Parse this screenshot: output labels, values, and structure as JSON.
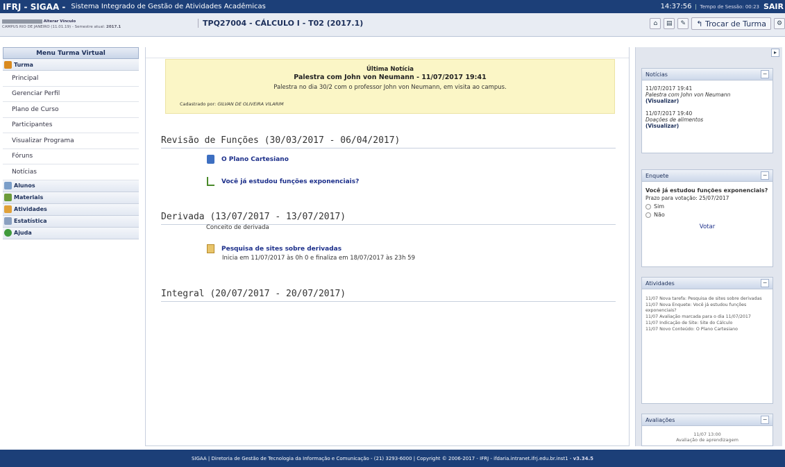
{
  "topbar": {
    "app_title": "IFRJ - SIGAA -",
    "system_name": "Sistema Integrado de Gestão de Atividades Acadêmicas",
    "time": "14:37:56",
    "session": "Tempo de Sessão: 00:23",
    "logout": "SAIR"
  },
  "header": {
    "change_link": "Alterar Vínculo",
    "campus": "CAMPUS RIO DE JANEIRO (11.01.19) - Semestre atual:",
    "semester": "2017.1",
    "course_title": "TPQ27004 - CÁLCULO I - T02 (2017.1)",
    "change_class": "Trocar de Turma"
  },
  "sidebar": {
    "title": "Menu Turma Virtual",
    "sections": [
      {
        "label": "Turma",
        "color": "#d98a1f"
      },
      {
        "label": "Alunos",
        "color": "#7a9ec9"
      },
      {
        "label": "Materiais",
        "color": "#6c9b3a"
      },
      {
        "label": "Atividades",
        "color": "#e0a13a"
      },
      {
        "label": "Estatística",
        "color": "#8aa0c0"
      },
      {
        "label": "Ajuda",
        "color": "#3f9a3c"
      }
    ],
    "turma_items": [
      "Principal",
      "Gerenciar Perfil",
      "Plano de Curso",
      "Participantes",
      "Visualizar Programa",
      "Fóruns",
      "Notícias"
    ]
  },
  "news": {
    "label": "Última Notícia",
    "headline": "Palestra com John von Neumann - 11/07/2017 19:41",
    "text": "Palestra no dia 30/2 com o professor John von Neumann, em visita ao campus.",
    "author_prefix": "Cadastrado por:",
    "author": "GILVAN DE OLIVEIRA VILARIM"
  },
  "topics": [
    {
      "title": "Revisão de Funções (30/03/2017 - 06/04/2017)"
    },
    {
      "title": "Derivada (13/07/2017 - 13/07/2017)",
      "subtitle": "Conceito de derivada"
    },
    {
      "title": "Integral (20/07/2017 - 20/07/2017)"
    }
  ],
  "resources": {
    "plano": "O Plano Cartesiano",
    "enquete": "Você já estudou funções exponenciais?",
    "pesquisa": "Pesquisa de sites sobre derivadas",
    "pesquisa_detail": "Inicia em 11/07/2017 às 0h 0 e finaliza em 18/07/2017 às 23h 59"
  },
  "right": {
    "noticias": {
      "title": "Notícias",
      "items": [
        {
          "date": "11/07/2017 19:41",
          "text": "Palestra com John von Neumann",
          "link": "(Visualizar)"
        },
        {
          "date": "11/07/2017 19:40",
          "text": "Doações de alimentos",
          "link": "(Visualizar)"
        }
      ]
    },
    "enquete": {
      "title": "Enquete",
      "question": "Você já estudou funções exponenciais?",
      "deadline": "Prazo para votação: 25/07/2017",
      "options": [
        "Sim",
        "Não"
      ],
      "vote": "Votar"
    },
    "atividades": {
      "title": "Atividades",
      "items": [
        "11/07 Nova tarefa: Pesquisa de sites sobre derivadas",
        "11/07 Nova Enquete: Você já estudou funções exponenciais?",
        "11/07 Avaliação marcada para o dia 11/07/2017",
        "11/07 Indicação de Site: Site do Cálculo",
        "11/07 Novo Conteúdo: O Plano Cartesiano"
      ]
    },
    "avaliacoes": {
      "title": "Avaliações",
      "date": "11/07 13:00",
      "text": "Avaliação de aprendizagem"
    }
  },
  "footer": {
    "text": "SIGAA | Diretoria de Gestão de Tecnologia da Informação e Comunicação - (21) 3293-6000 | Copyright © 2006-2017 - IFRJ - ifdaria.intranet.ifrj.edu.br.inst1 -",
    "version": "v3.34.5"
  }
}
